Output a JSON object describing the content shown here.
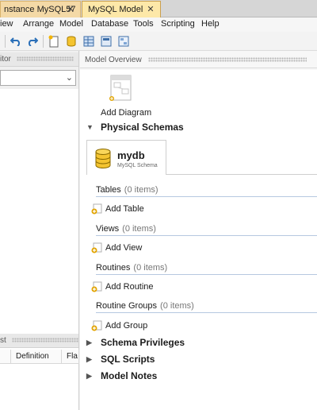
{
  "tabs": [
    {
      "label": "nstance MySQL57",
      "close": "✕"
    },
    {
      "label": "MySQL Model",
      "close": "✕"
    }
  ],
  "menu": [
    "iew",
    "Arrange",
    "Model",
    "Database",
    "Tools",
    "Scripting",
    "Help"
  ],
  "left_panel": {
    "title": "itor",
    "bottom_title": "st",
    "columns": [
      "Definition",
      "Fla"
    ]
  },
  "model_overview": {
    "title": "Model Overview",
    "add_diagram_label": "Add Diagram",
    "physical_schemas_label": "Physical Schemas",
    "schema": {
      "name": "mydb",
      "subtitle": "MySQL Schema"
    },
    "groups": [
      {
        "name": "Tables",
        "count": "(0 items)",
        "add_label": "Add Table"
      },
      {
        "name": "Views",
        "count": "(0 items)",
        "add_label": "Add View"
      },
      {
        "name": "Routines",
        "count": "(0 items)",
        "add_label": "Add Routine"
      },
      {
        "name": "Routine Groups",
        "count": "(0 items)",
        "add_label": "Add Group"
      }
    ],
    "collapsed_sections": [
      "Schema Privileges",
      "SQL Scripts",
      "Model Notes"
    ]
  },
  "colors": {
    "active_tab": "#fde8a8",
    "inactive_tab": "#f4d9a6",
    "group_divider": "#b6c8e0",
    "add_icon_plus": "#e2a400"
  },
  "icons": [
    "close-icon",
    "undo-icon",
    "redo-icon",
    "new-document-icon",
    "open-database-icon",
    "table-icon",
    "grid-icon",
    "diagram-icon",
    "database-icon",
    "add-icon",
    "expand-triangle-icon"
  ]
}
